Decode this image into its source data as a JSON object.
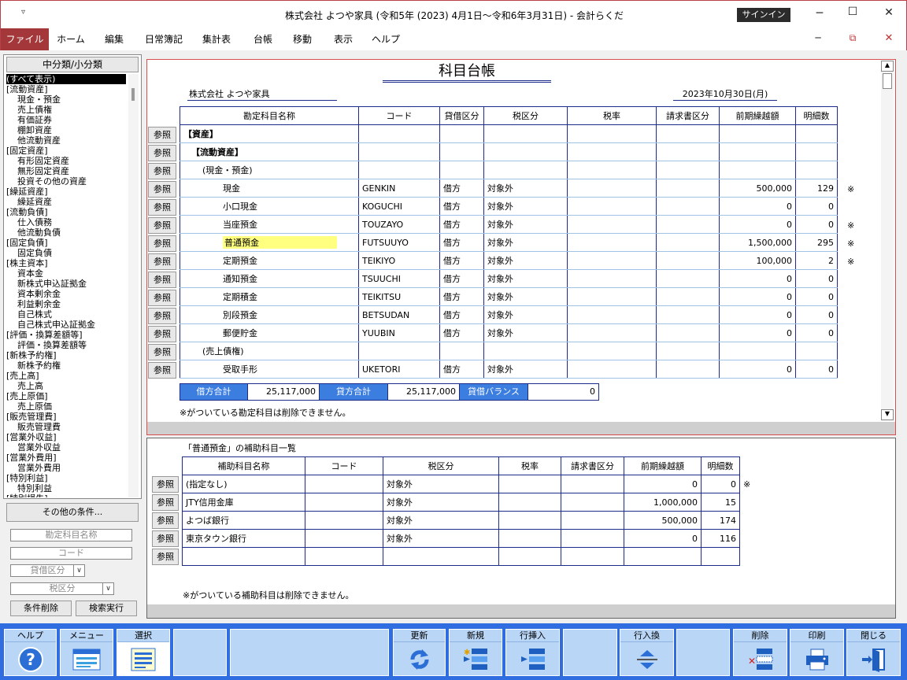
{
  "window": {
    "title": "株式会社 よつや家具 (令和5年 (2023) 4月1日～令和6年3月31日) - 会計らくだ",
    "signin": "サインイン",
    "qa_icon": "▿",
    "min": "─",
    "max": "☐",
    "close": "✕",
    "ribbon_min": "─",
    "ribbon_restore": "⧉",
    "ribbon_close": "✕"
  },
  "menu": [
    "ファイル",
    "ホーム",
    "編集",
    "日常簿記",
    "集計表",
    "台帳",
    "移動",
    "表示",
    "ヘルプ"
  ],
  "left": {
    "header": "中分類/小分類",
    "tree": [
      {
        "t": "(すべて表示)",
        "sel": true
      },
      {
        "t": "[流動資産]"
      },
      {
        "t": "現金・預金",
        "c": 1
      },
      {
        "t": "売上債権",
        "c": 1
      },
      {
        "t": "有価証券",
        "c": 1
      },
      {
        "t": "棚卸資産",
        "c": 1
      },
      {
        "t": "他流動資産",
        "c": 1
      },
      {
        "t": "[固定資産]"
      },
      {
        "t": "有形固定資産",
        "c": 1
      },
      {
        "t": "無形固定資産",
        "c": 1
      },
      {
        "t": "投資その他の資産",
        "c": 1
      },
      {
        "t": "[繰延資産]"
      },
      {
        "t": "繰延資産",
        "c": 1
      },
      {
        "t": "[流動負債]"
      },
      {
        "t": "仕入債務",
        "c": 1
      },
      {
        "t": "他流動負債",
        "c": 1
      },
      {
        "t": "[固定負債]"
      },
      {
        "t": "固定負債",
        "c": 1
      },
      {
        "t": "[株主資本]"
      },
      {
        "t": "資本金",
        "c": 1
      },
      {
        "t": "新株式申込証拠金",
        "c": 1
      },
      {
        "t": "資本剰余金",
        "c": 1
      },
      {
        "t": "利益剰余金",
        "c": 1
      },
      {
        "t": "自己株式",
        "c": 1
      },
      {
        "t": "自己株式申込証拠金",
        "c": 1
      },
      {
        "t": "[評価・換算差額等]"
      },
      {
        "t": "評価・換算差額等",
        "c": 1
      },
      {
        "t": "[新株予約権]"
      },
      {
        "t": "新株予約権",
        "c": 1
      },
      {
        "t": "[売上高]"
      },
      {
        "t": "売上高",
        "c": 1
      },
      {
        "t": "[売上原価]"
      },
      {
        "t": "売上原価",
        "c": 1
      },
      {
        "t": "[販売管理費]"
      },
      {
        "t": "販売管理費",
        "c": 1
      },
      {
        "t": "[営業外収益]"
      },
      {
        "t": "営業外収益",
        "c": 1
      },
      {
        "t": "[営業外費用]"
      },
      {
        "t": "営業外費用",
        "c": 1
      },
      {
        "t": "[特別利益]"
      },
      {
        "t": "特別利益",
        "c": 1
      },
      {
        "t": "[特別損失]"
      }
    ],
    "other_conditions": "その他の条件...",
    "field_name": "勘定科目名称",
    "field_code": "コード",
    "field_kashikari": "貸借区分",
    "field_tax": "税区分",
    "btn_clear": "条件削除",
    "btn_search": "検索実行"
  },
  "ledger": {
    "title": "科目台帳",
    "company": "株式会社 よつや家具",
    "date": "2023年10月30日(月)",
    "ref_label": "参照",
    "headers": [
      "勘定科目名称",
      "コード",
      "貸借区分",
      "税区分",
      "税率",
      "請求書区分",
      "前期繰越額",
      "明細数"
    ],
    "rows": [
      {
        "name": "【資産】",
        "indent": 0,
        "bold": true,
        "code": "",
        "kk": "",
        "tax": "",
        "rate": "",
        "inv": "",
        "prev": "",
        "cnt": "",
        "mark": ""
      },
      {
        "name": "【流動資産】",
        "indent": 1,
        "bold": true,
        "code": "",
        "kk": "",
        "tax": "",
        "rate": "",
        "inv": "",
        "prev": "",
        "cnt": "",
        "mark": ""
      },
      {
        "name": "(現金・預金)",
        "indent": 2,
        "code": "",
        "kk": "",
        "tax": "",
        "rate": "",
        "inv": "",
        "prev": "",
        "cnt": "",
        "mark": ""
      },
      {
        "name": "現金",
        "indent": 3,
        "code": "GENKIN",
        "kk": "借方",
        "tax": "対象外",
        "rate": "",
        "inv": "",
        "prev": "500,000",
        "cnt": "129",
        "mark": "※"
      },
      {
        "name": "小口現金",
        "indent": 3,
        "code": "KOGUCHI",
        "kk": "借方",
        "tax": "対象外",
        "rate": "",
        "inv": "",
        "prev": "0",
        "cnt": "0",
        "mark": ""
      },
      {
        "name": "当座預金",
        "indent": 3,
        "code": "TOUZAYO",
        "kk": "借方",
        "tax": "対象外",
        "rate": "",
        "inv": "",
        "prev": "0",
        "cnt": "0",
        "mark": "※"
      },
      {
        "name": "普通預金",
        "indent": 3,
        "hl": true,
        "code": "FUTSUUYO",
        "kk": "借方",
        "tax": "対象外",
        "rate": "",
        "inv": "",
        "prev": "1,500,000",
        "cnt": "295",
        "mark": "※"
      },
      {
        "name": "定期預金",
        "indent": 3,
        "code": "TEIKIYO",
        "kk": "借方",
        "tax": "対象外",
        "rate": "",
        "inv": "",
        "prev": "100,000",
        "cnt": "2",
        "mark": "※"
      },
      {
        "name": "通知預金",
        "indent": 3,
        "code": "TSUUCHI",
        "kk": "借方",
        "tax": "対象外",
        "rate": "",
        "inv": "",
        "prev": "0",
        "cnt": "0",
        "mark": ""
      },
      {
        "name": "定期積金",
        "indent": 3,
        "code": "TEIKITSU",
        "kk": "借方",
        "tax": "対象外",
        "rate": "",
        "inv": "",
        "prev": "0",
        "cnt": "0",
        "mark": ""
      },
      {
        "name": "別段預金",
        "indent": 3,
        "code": "BETSUDAN",
        "kk": "借方",
        "tax": "対象外",
        "rate": "",
        "inv": "",
        "prev": "0",
        "cnt": "0",
        "mark": ""
      },
      {
        "name": "郵便貯金",
        "indent": 3,
        "code": "YUUBIN",
        "kk": "借方",
        "tax": "対象外",
        "rate": "",
        "inv": "",
        "prev": "0",
        "cnt": "0",
        "mark": ""
      },
      {
        "name": "(売上債権)",
        "indent": 2,
        "code": "",
        "kk": "",
        "tax": "",
        "rate": "",
        "inv": "",
        "prev": "",
        "cnt": "",
        "mark": ""
      },
      {
        "name": "受取手形",
        "indent": 3,
        "code": "UKETORI",
        "kk": "借方",
        "tax": "対象外",
        "rate": "",
        "inv": "",
        "prev": "0",
        "cnt": "0",
        "mark": ""
      }
    ],
    "debit_label": "借方合計",
    "debit_value": "25,117,000",
    "credit_label": "貸方合計",
    "credit_value": "25,117,000",
    "balance_label": "貸借バランス",
    "balance_value": "0",
    "note": "※がついている勘定科目は削除できません。"
  },
  "sub": {
    "title": "「普通預金」の補助科目一覧",
    "headers": [
      "補助科目名称",
      "コード",
      "税区分",
      "税率",
      "請求書区分",
      "前期繰越額",
      "明細数"
    ],
    "rows": [
      {
        "name": "(指定なし)",
        "code": "",
        "tax": "対象外",
        "rate": "",
        "inv": "",
        "prev": "0",
        "cnt": "0",
        "mark": "※"
      },
      {
        "name": "JTY信用金庫",
        "code": "",
        "tax": "対象外",
        "rate": "",
        "inv": "",
        "prev": "1,000,000",
        "cnt": "15",
        "mark": ""
      },
      {
        "name": "よつば銀行",
        "code": "",
        "tax": "対象外",
        "rate": "",
        "inv": "",
        "prev": "500,000",
        "cnt": "174",
        "mark": ""
      },
      {
        "name": "東京タウン銀行",
        "code": "",
        "tax": "対象外",
        "rate": "",
        "inv": "",
        "prev": "0",
        "cnt": "116",
        "mark": ""
      },
      {
        "name": "",
        "code": "",
        "tax": "",
        "rate": "",
        "inv": "",
        "prev": "",
        "cnt": "",
        "mark": ""
      }
    ],
    "note": "※がついている補助科目は削除できません。"
  },
  "toolbar": {
    "help": "ヘルプ",
    "menu": "メニュー",
    "select": "選択",
    "refresh": "更新",
    "new": "新規",
    "insert": "行挿入",
    "swap": "行入換",
    "delete": "削除",
    "print": "印刷",
    "close": "閉じる"
  },
  "colors": {
    "accent": "#a4373a",
    "toolbar": "#2f6de0",
    "tile": "#b9d6f7",
    "grid": "#1c2a8c",
    "highlight": "#ffff80"
  }
}
